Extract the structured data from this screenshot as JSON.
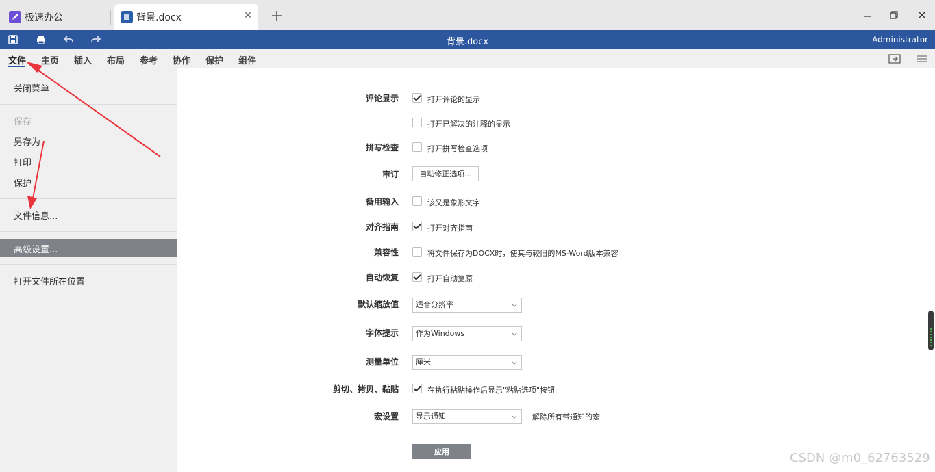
{
  "tabs": [
    {
      "label": "极速办公",
      "icon": "rocket-icon"
    },
    {
      "label": "背景.docx",
      "icon": "document-icon",
      "active": true
    }
  ],
  "titlebar": {
    "title": "背景.docx",
    "user": "Administrator"
  },
  "menu": [
    "文件",
    "主页",
    "插入",
    "布局",
    "参考",
    "协作",
    "保护",
    "组件"
  ],
  "left_menu": {
    "close": "关闭菜单",
    "save": "保存",
    "save_as": "另存为",
    "print": "打印",
    "protect": "保护",
    "file_info": "文件信息...",
    "advanced": "高级设置...",
    "open_location": "打开文件所在位置"
  },
  "settings": {
    "comments_label": "评论显示",
    "comments_opt1": "打开评论的显示",
    "comments_opt2": "打开已解决的注释的显示",
    "spell_label": "拼写检查",
    "spell_opt": "打开拼写检查选项",
    "review_label": "审订",
    "autocorrect_btn": "自动修正选项...",
    "alt_input_label": "备用输入",
    "alt_input_opt": "该又是象形文字",
    "align_label": "对齐指南",
    "align_opt": "打开对齐指南",
    "compat_label": "兼容性",
    "compat_opt": "将文件保存为DOCX时，使其与较旧的MS-Word版本兼容",
    "autorecover_label": "自动恢复",
    "autorecover_opt": "打开自动复原",
    "zoom_label": "默认缩放值",
    "zoom_value": "适合分辨率",
    "hinting_label": "字体提示",
    "hinting_value": "作为Windows",
    "unit_label": "测量单位",
    "unit_value": "厘米",
    "paste_label": "剪切、拷贝、黏贴",
    "paste_opt": "在执行粘贴操作后显示\"粘贴选项\"按钮",
    "macro_label": "宏设置",
    "macro_value": "显示通知",
    "macro_note": "解除所有带通知的宏",
    "apply": "应用"
  },
  "checkbox_states": {
    "comments_opt1": true,
    "comments_opt2": false,
    "spell_opt": false,
    "alt_input_opt": false,
    "align_opt": true,
    "compat_opt": false,
    "autorecover_opt": true,
    "paste_opt": true
  },
  "watermark": "CSDN @m0_62763529",
  "colors": {
    "titlebar": "#2c579e",
    "selected": "#7f8389",
    "annotation_arrow": "#e8343a"
  }
}
